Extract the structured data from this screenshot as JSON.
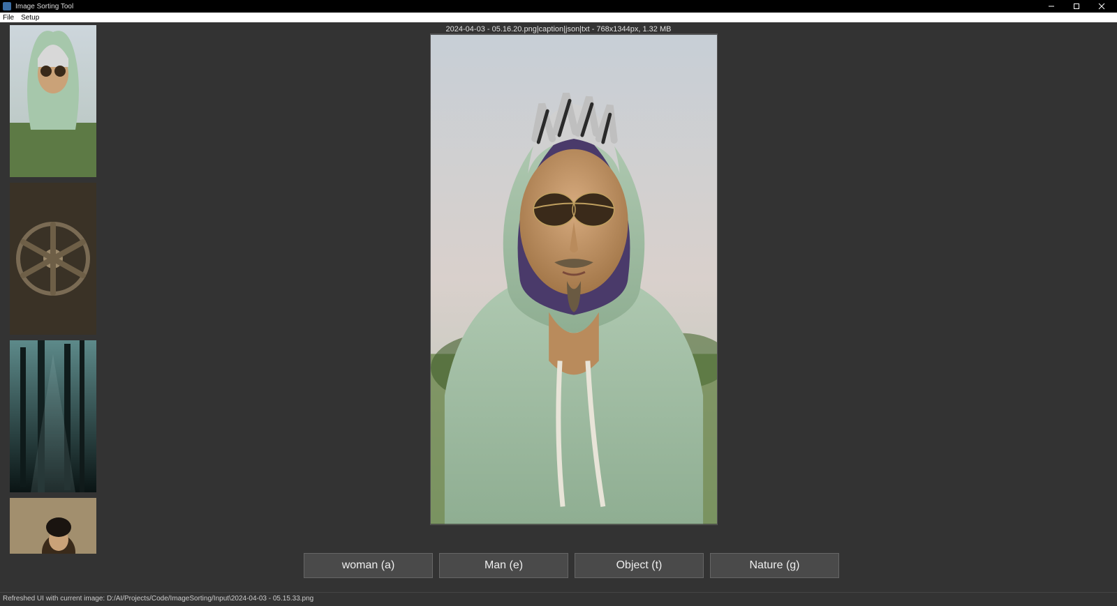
{
  "window": {
    "title": "Image Sorting Tool"
  },
  "menu": {
    "items": [
      "File",
      "Setup"
    ]
  },
  "info": {
    "label": "2024-04-03 - 05.16.20.png|caption|json|txt - 768x1344px, 1.32 MB"
  },
  "buttons": [
    {
      "label": "woman (a)"
    },
    {
      "label": "Man (e)"
    },
    {
      "label": "Object (t)"
    },
    {
      "label": "Nature (g)"
    }
  ],
  "status": {
    "text": "Refreshed UI with current image: D:/AI/Projects/Code/ImageSorting/Input\\2024-04-03 - 05.15.33.png"
  }
}
